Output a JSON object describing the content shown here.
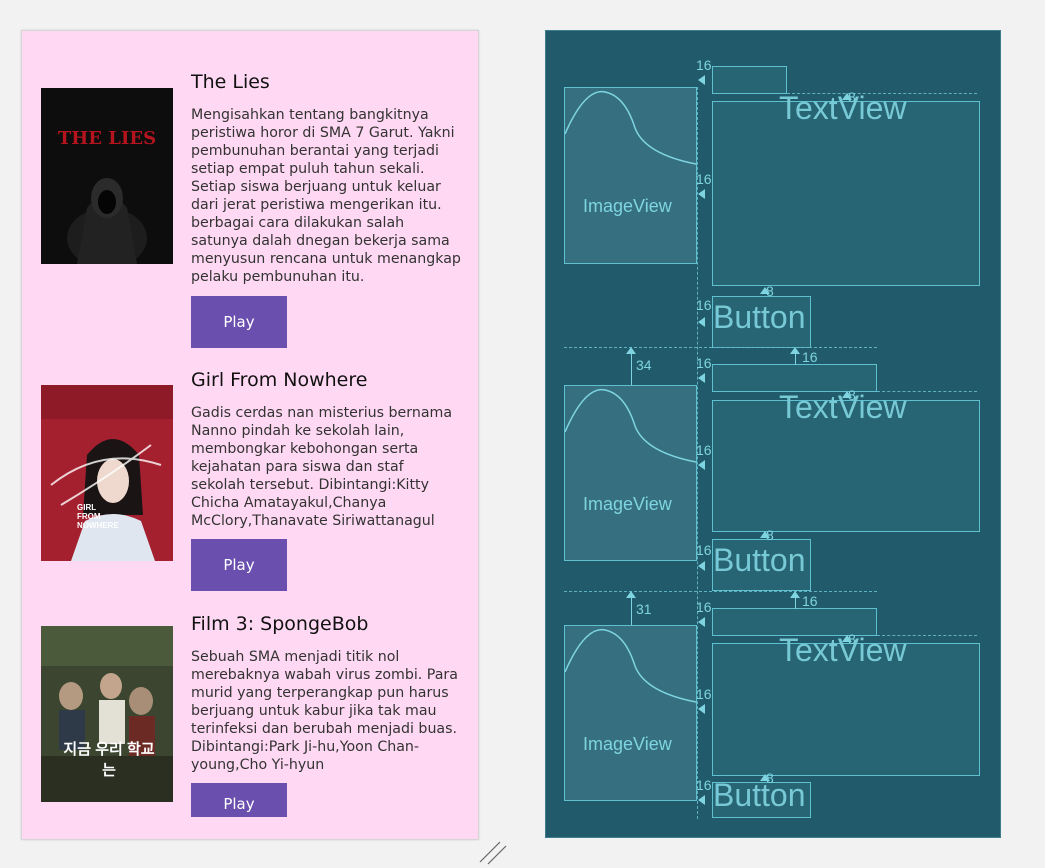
{
  "design": {
    "items": [
      {
        "title": "The Lies",
        "description": "Mengisahkan tentang bangkitnya peristiwa horor di SMA 7 Garut. Yakni pembunuhan berantai yang terjadi setiap empat puluh tahun sekali. Setiap siswa berjuang untuk keluar dari jerat peristiwa mengerikan itu. berbagai cara dilakukan salah satunya dalah dnegan bekerja sama menyusun rencana untuk menangkap pelaku pembunuhan itu.",
        "button": "Play",
        "poster_text": "THE LIES"
      },
      {
        "title": "Girl From Nowhere",
        "description": "Gadis cerdas nan misterius bernama Nanno pindah ke sekolah lain, membongkar kebohongan serta kejahatan para siswa dan staf sekolah tersebut. Dibintangi:Kitty Chicha Amatayakul,Chanya McClory,Thanavate Siriwattanagul",
        "button": "Play",
        "poster_text": "GIRL FROM NOWHERE"
      },
      {
        "title": "Film 3: SpongeBob",
        "description": "Sebuah SMA menjadi titik nol merebaknya wabah virus zombi. Para murid yang terperangkap pun harus berjuang untuk kabur jika tak mau terinfeksi dan berubah menjadi buas. Dibintangi:Park Ji-hu,Yoon Chan-young,Cho Yi-hyun",
        "button": "Play",
        "poster_text": "지금 우리 학교는"
      }
    ]
  },
  "blueprint": {
    "imageview_label": "ImageView",
    "textview_label": "TextView",
    "button_label": "Button",
    "margins": {
      "m16": "16",
      "m8": "8",
      "m34": "34",
      "m31": "31"
    }
  },
  "colors": {
    "design_bg": "#ffd9f3",
    "button": "#6a4fae",
    "blueprint_bg": "#215a6a",
    "blueprint_line": "#5fc0d0"
  }
}
